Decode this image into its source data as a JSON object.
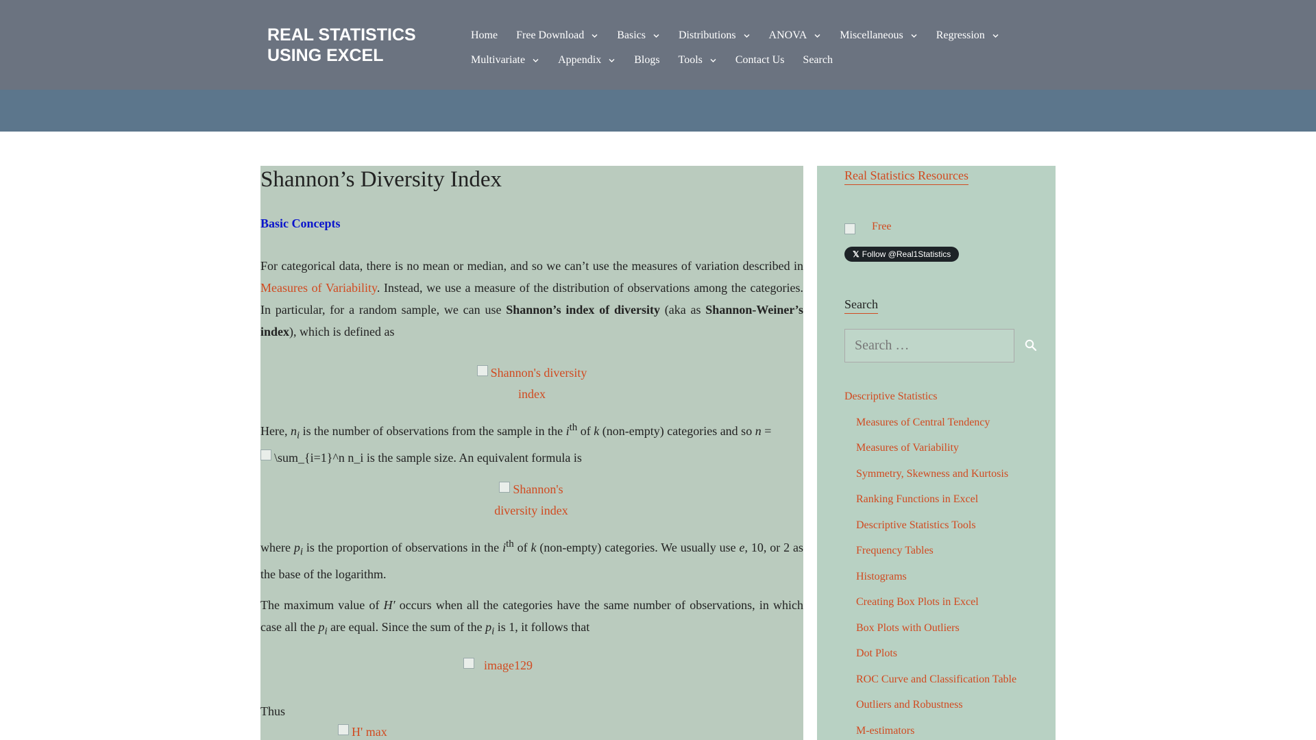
{
  "site": {
    "title_line1": "REAL STATISTICS",
    "title_line2": "USING EXCEL"
  },
  "nav": {
    "row1": [
      {
        "label": "Home",
        "dropdown": false
      },
      {
        "label": "Free Download",
        "dropdown": true
      },
      {
        "label": "Basics",
        "dropdown": true
      },
      {
        "label": "Distributions",
        "dropdown": true
      },
      {
        "label": "ANOVA",
        "dropdown": true
      },
      {
        "label": "Miscellaneous",
        "dropdown": true
      },
      {
        "label": "Regression",
        "dropdown": true
      }
    ],
    "row2": [
      {
        "label": "Multivariate",
        "dropdown": true
      },
      {
        "label": "Appendix",
        "dropdown": true
      },
      {
        "label": "Blogs",
        "dropdown": false
      },
      {
        "label": "Tools",
        "dropdown": true
      },
      {
        "label": "Contact Us",
        "dropdown": false
      },
      {
        "label": "Search",
        "dropdown": false
      }
    ]
  },
  "article": {
    "title": "Shannon’s Diversity Index",
    "section": "Basic Concepts",
    "p1_a": "For categorical data, there is no mean or median, and so we can’t use the measures of variation described in ",
    "p1_link": "Measures of Variability",
    "p1_b": ". Instead, we use a measure of the distribution of observations among the categories. In particular, for a random sample, we can use ",
    "p1_bold1": "Shannon’s index of diversity",
    "p1_c": " (aka as ",
    "p1_bold2": "Shannon-Weiner’s index",
    "p1_d": "), which is defined as",
    "eq1_alt": "Shannon's diversity index",
    "p2_a": "Here, ",
    "p2_n": "n",
    "p2_i": "i",
    "p2_b": " is the number of observations from the sample in the ",
    "p2_i2": "i",
    "p2_th": "th",
    "p2_c": " of ",
    "p2_k": "k",
    "p2_d": " (non-empty) categories and so ",
    "p2_n2": "n",
    "p2_eq": " =",
    "p2_img_alt": "\\sum_{i=1}^n n_i",
    "p2_e": " is the sample size. An equivalent formula is",
    "eq2_alt": "Shannon's diversity index",
    "p3_a": "where ",
    "p3_p": "p",
    "p3_i": "i",
    "p3_b": " is the proportion of observations in the ",
    "p3_i2": "i",
    "p3_th": "th",
    "p3_c": " of ",
    "p3_k": "k",
    "p3_d": " (non-empty) categories. We usually use ",
    "p3_e_it": "e",
    "p3_e": ", 10, or 2 as the base of the logarithm.",
    "p4_a": "The maximum value of ",
    "p4_h": "H′",
    "p4_b": " occurs when all the categories have the same number of observations, in which case all the ",
    "p4_p": "p",
    "p4_i": "i",
    "p4_c": " are equal. Since the sum of the ",
    "p4_p2": "p",
    "p4_i2": "i",
    "p4_d": " is 1, it follows that",
    "eq3_alt": "image129",
    "thus": "Thus",
    "eq4_alt": "H' max"
  },
  "sidebar": {
    "resources_title": "Real Statistics Resources",
    "free_label": "Free",
    "follow_label": "Follow @Real1Statistics",
    "search_title": "Search",
    "search_placeholder": "Search …",
    "list": [
      {
        "label": "Descriptive Statistics",
        "level": 0
      },
      {
        "label": "Measures of Central Tendency",
        "level": 1
      },
      {
        "label": "Measures of Variability",
        "level": 1
      },
      {
        "label": "Symmetry, Skewness and Kurtosis",
        "level": 1
      },
      {
        "label": "Ranking Functions in Excel",
        "level": 1
      },
      {
        "label": "Descriptive Statistics Tools",
        "level": 1
      },
      {
        "label": "Frequency Tables",
        "level": 1
      },
      {
        "label": "Histograms",
        "level": 1
      },
      {
        "label": "Creating Box Plots in Excel",
        "level": 1
      },
      {
        "label": "Box Plots with Outliers",
        "level": 1
      },
      {
        "label": "Dot Plots",
        "level": 1
      },
      {
        "label": "ROC Curve and Classification Table",
        "level": 1
      },
      {
        "label": "Outliers and Robustness",
        "level": 1
      },
      {
        "label": "M-estimators",
        "level": 1
      }
    ]
  },
  "colors": {
    "header": "#6b7380",
    "band": "#5c768c",
    "content_bg": "#bacbbe",
    "sidebar_bg": "#b8d1c3",
    "link": "#d14a20",
    "section_head": "#0a14cc"
  }
}
